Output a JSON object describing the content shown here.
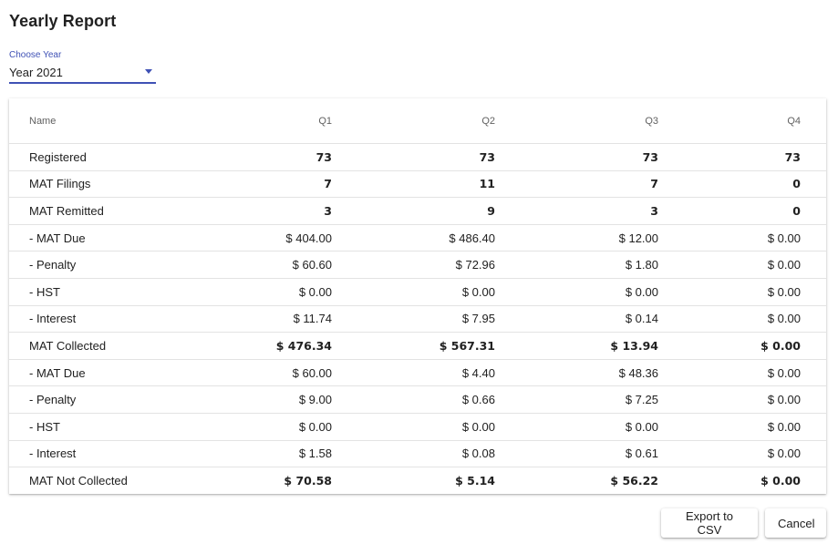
{
  "page": {
    "title": "Yearly Report"
  },
  "year_select": {
    "label": "Choose Year",
    "value": "Year 2021"
  },
  "table": {
    "columns": [
      "Name",
      "Q1",
      "Q2",
      "Q3",
      "Q4"
    ],
    "rows": [
      {
        "name": "Registered",
        "bold": true,
        "values": [
          "73",
          "73",
          "73",
          "73"
        ]
      },
      {
        "name": "MAT Filings",
        "bold": true,
        "values": [
          "7",
          "11",
          "7",
          "0"
        ]
      },
      {
        "name": "MAT Remitted",
        "bold": true,
        "values": [
          "3",
          "9",
          "3",
          "0"
        ]
      },
      {
        "name": "- MAT Due",
        "bold": false,
        "values": [
          "$ 404.00",
          "$ 486.40",
          "$ 12.00",
          "$ 0.00"
        ]
      },
      {
        "name": "- Penalty",
        "bold": false,
        "values": [
          "$ 60.60",
          "$ 72.96",
          "$ 1.80",
          "$ 0.00"
        ]
      },
      {
        "name": "- HST",
        "bold": false,
        "values": [
          "$ 0.00",
          "$ 0.00",
          "$ 0.00",
          "$ 0.00"
        ]
      },
      {
        "name": "- Interest",
        "bold": false,
        "values": [
          "$ 11.74",
          "$ 7.95",
          "$ 0.14",
          "$ 0.00"
        ]
      },
      {
        "name": "MAT Collected",
        "bold": true,
        "values": [
          "$ 476.34",
          "$ 567.31",
          "$ 13.94",
          "$ 0.00"
        ]
      },
      {
        "name": "- MAT Due",
        "bold": false,
        "values": [
          "$ 60.00",
          "$ 4.40",
          "$ 48.36",
          "$ 0.00"
        ]
      },
      {
        "name": "- Penalty",
        "bold": false,
        "values": [
          "$ 9.00",
          "$ 0.66",
          "$ 7.25",
          "$ 0.00"
        ]
      },
      {
        "name": "- HST",
        "bold": false,
        "values": [
          "$ 0.00",
          "$ 0.00",
          "$ 0.00",
          "$ 0.00"
        ]
      },
      {
        "name": "- Interest",
        "bold": false,
        "values": [
          "$ 1.58",
          "$ 0.08",
          "$ 0.61",
          "$ 0.00"
        ]
      },
      {
        "name": "MAT Not Collected",
        "bold": true,
        "values": [
          "$ 70.58",
          "$ 5.14",
          "$ 56.22",
          "$ 0.00"
        ]
      }
    ]
  },
  "buttons": {
    "export": "Export to CSV",
    "cancel": "Cancel"
  },
  "colors": {
    "accent": "#3f51b5"
  }
}
